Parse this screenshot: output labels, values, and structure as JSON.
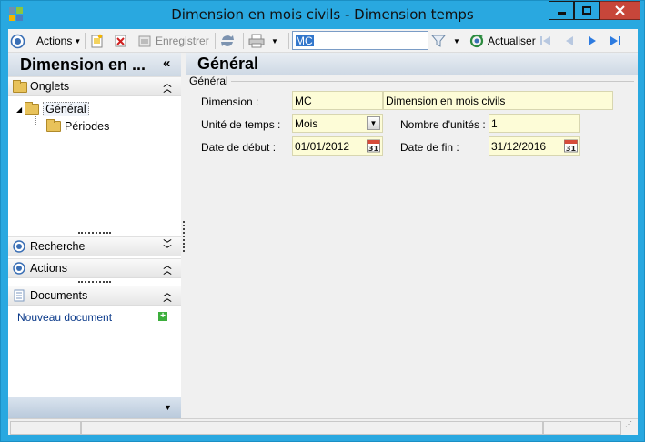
{
  "window": {
    "title": "Dimension en mois civils -  Dimension temps"
  },
  "toolbar": {
    "actions_label": "Actions",
    "save_label": "Enregistrer",
    "search_value": "MC",
    "refresh_label": "Actualiser"
  },
  "left": {
    "title": "Dimension en ...",
    "tabs_section": "Onglets",
    "tree": [
      {
        "label": "Général"
      },
      {
        "label": "Périodes"
      }
    ],
    "search_section": "Recherche",
    "actions_section": "Actions",
    "documents_section": "Documents",
    "new_document": "Nouveau document"
  },
  "main": {
    "title": "Général",
    "group": "Général",
    "fields": {
      "dimension_label": "Dimension :",
      "dimension_code": "MC",
      "dimension_name": "Dimension en mois civils",
      "unit_label": "Unité de temps :",
      "unit_value": "Mois",
      "count_label": "Nombre d'unités :",
      "count_value": "1",
      "start_label": "Date de début :",
      "start_value": "01/01/2012",
      "end_label": "Date de fin :",
      "end_value": "31/12/2016",
      "calendar_day": "31"
    }
  },
  "colors": {
    "accent": "#29a8e0",
    "field_bg": "#fdfcd7",
    "close": "#c7463a"
  }
}
